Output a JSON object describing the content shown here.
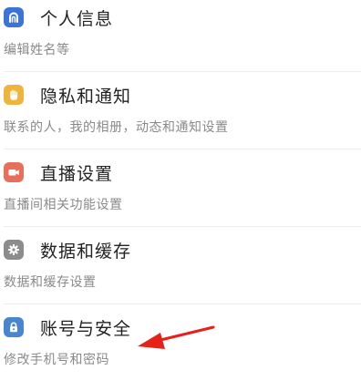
{
  "settings": {
    "items": [
      {
        "title": "个人信息",
        "subtitle": "编辑姓名等",
        "icon": "person-icon",
        "color": "#3a74d9"
      },
      {
        "title": "隐私和通知",
        "subtitle": "联系的人，我的相册，动态和通知设置",
        "icon": "hand-icon",
        "color": "#f0b43c"
      },
      {
        "title": "直播设置",
        "subtitle": "直播间相关功能设置",
        "icon": "video-camera-icon",
        "color": "#e8705a"
      },
      {
        "title": "数据和缓存",
        "subtitle": "数据和缓存设置",
        "icon": "gear-icon",
        "color": "#8c8c8c"
      },
      {
        "title": "账号与安全",
        "subtitle": "修改手机号和密码",
        "icon": "lock-icon",
        "color": "#4a86d0"
      }
    ]
  },
  "annotation": {
    "icon": "arrow-icon",
    "color": "#e8201a"
  }
}
